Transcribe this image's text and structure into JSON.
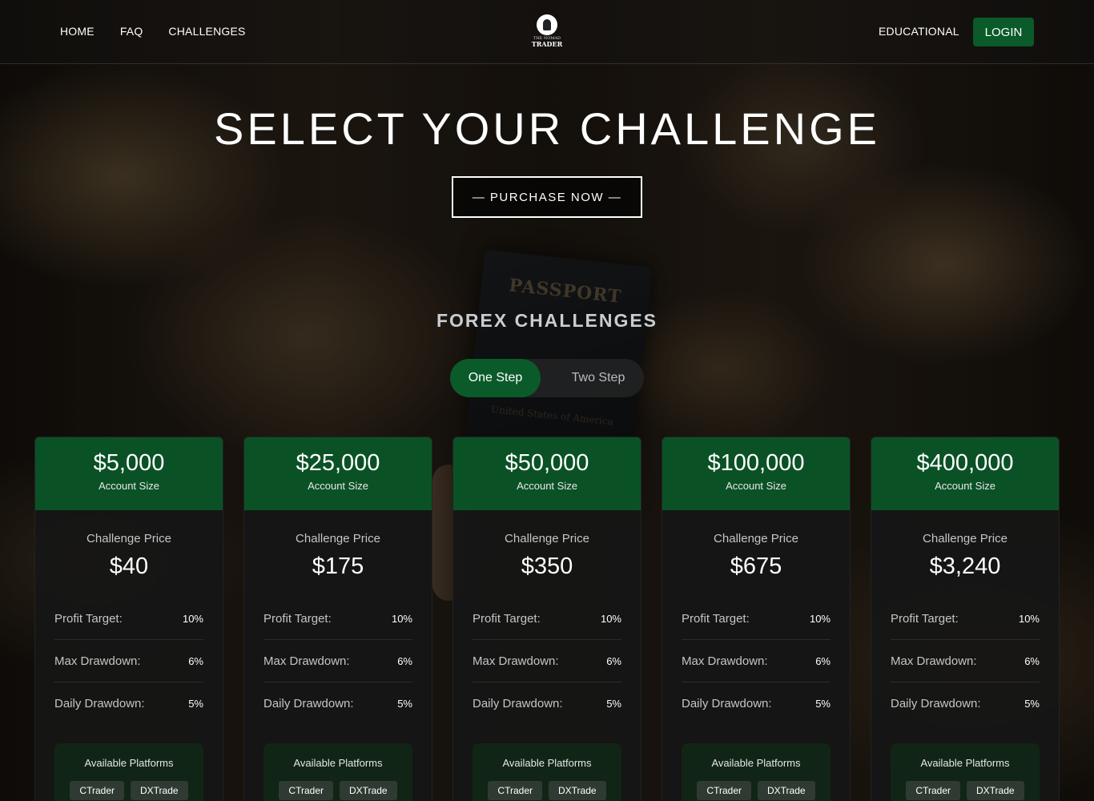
{
  "nav": {
    "home": "HOME",
    "faq": "FAQ",
    "challenges": "CHALLENGES",
    "educational": "EDUCATIONAL",
    "login": "LOGIN"
  },
  "logo": {
    "line1": "THE NOMAD",
    "line2": "TRADER"
  },
  "hero": {
    "title": "SELECT YOUR CHALLENGE",
    "button": "— PURCHASE NOW —"
  },
  "background": {
    "passport_text": "PASSPORT",
    "passport_sub": "United States of America"
  },
  "section": {
    "title": "FOREX CHALLENGES",
    "toggle": [
      "One Step",
      "Two Step"
    ],
    "active_toggle": "One Step"
  },
  "labels": {
    "account_size": "Account Size",
    "challenge_price": "Challenge Price",
    "profit_target": "Profit Target:",
    "max_drawdown": "Max Drawdown:",
    "daily_drawdown": "Daily Drawdown:",
    "available_platforms": "Available Platforms"
  },
  "cards": [
    {
      "size": "$5,000",
      "price": "$40",
      "profit_target": "10%",
      "max_drawdown": "6%",
      "daily_drawdown": "5%",
      "platforms": [
        "CTrader",
        "DXTrade"
      ]
    },
    {
      "size": "$25,000",
      "price": "$175",
      "profit_target": "10%",
      "max_drawdown": "6%",
      "daily_drawdown": "5%",
      "platforms": [
        "CTrader",
        "DXTrade"
      ]
    },
    {
      "size": "$50,000",
      "price": "$350",
      "profit_target": "10%",
      "max_drawdown": "6%",
      "daily_drawdown": "5%",
      "platforms": [
        "CTrader",
        "DXTrade"
      ]
    },
    {
      "size": "$100,000",
      "price": "$675",
      "profit_target": "10%",
      "max_drawdown": "6%",
      "daily_drawdown": "5%",
      "platforms": [
        "CTrader",
        "DXTrade"
      ]
    },
    {
      "size": "$400,000",
      "price": "$3,240",
      "profit_target": "10%",
      "max_drawdown": "6%",
      "daily_drawdown": "5%",
      "platforms": [
        "CTrader",
        "DXTrade"
      ]
    }
  ],
  "colors": {
    "brand_green": "#0b5a2a",
    "card_header_green": "#0a5226",
    "card_bg": "#161616"
  }
}
